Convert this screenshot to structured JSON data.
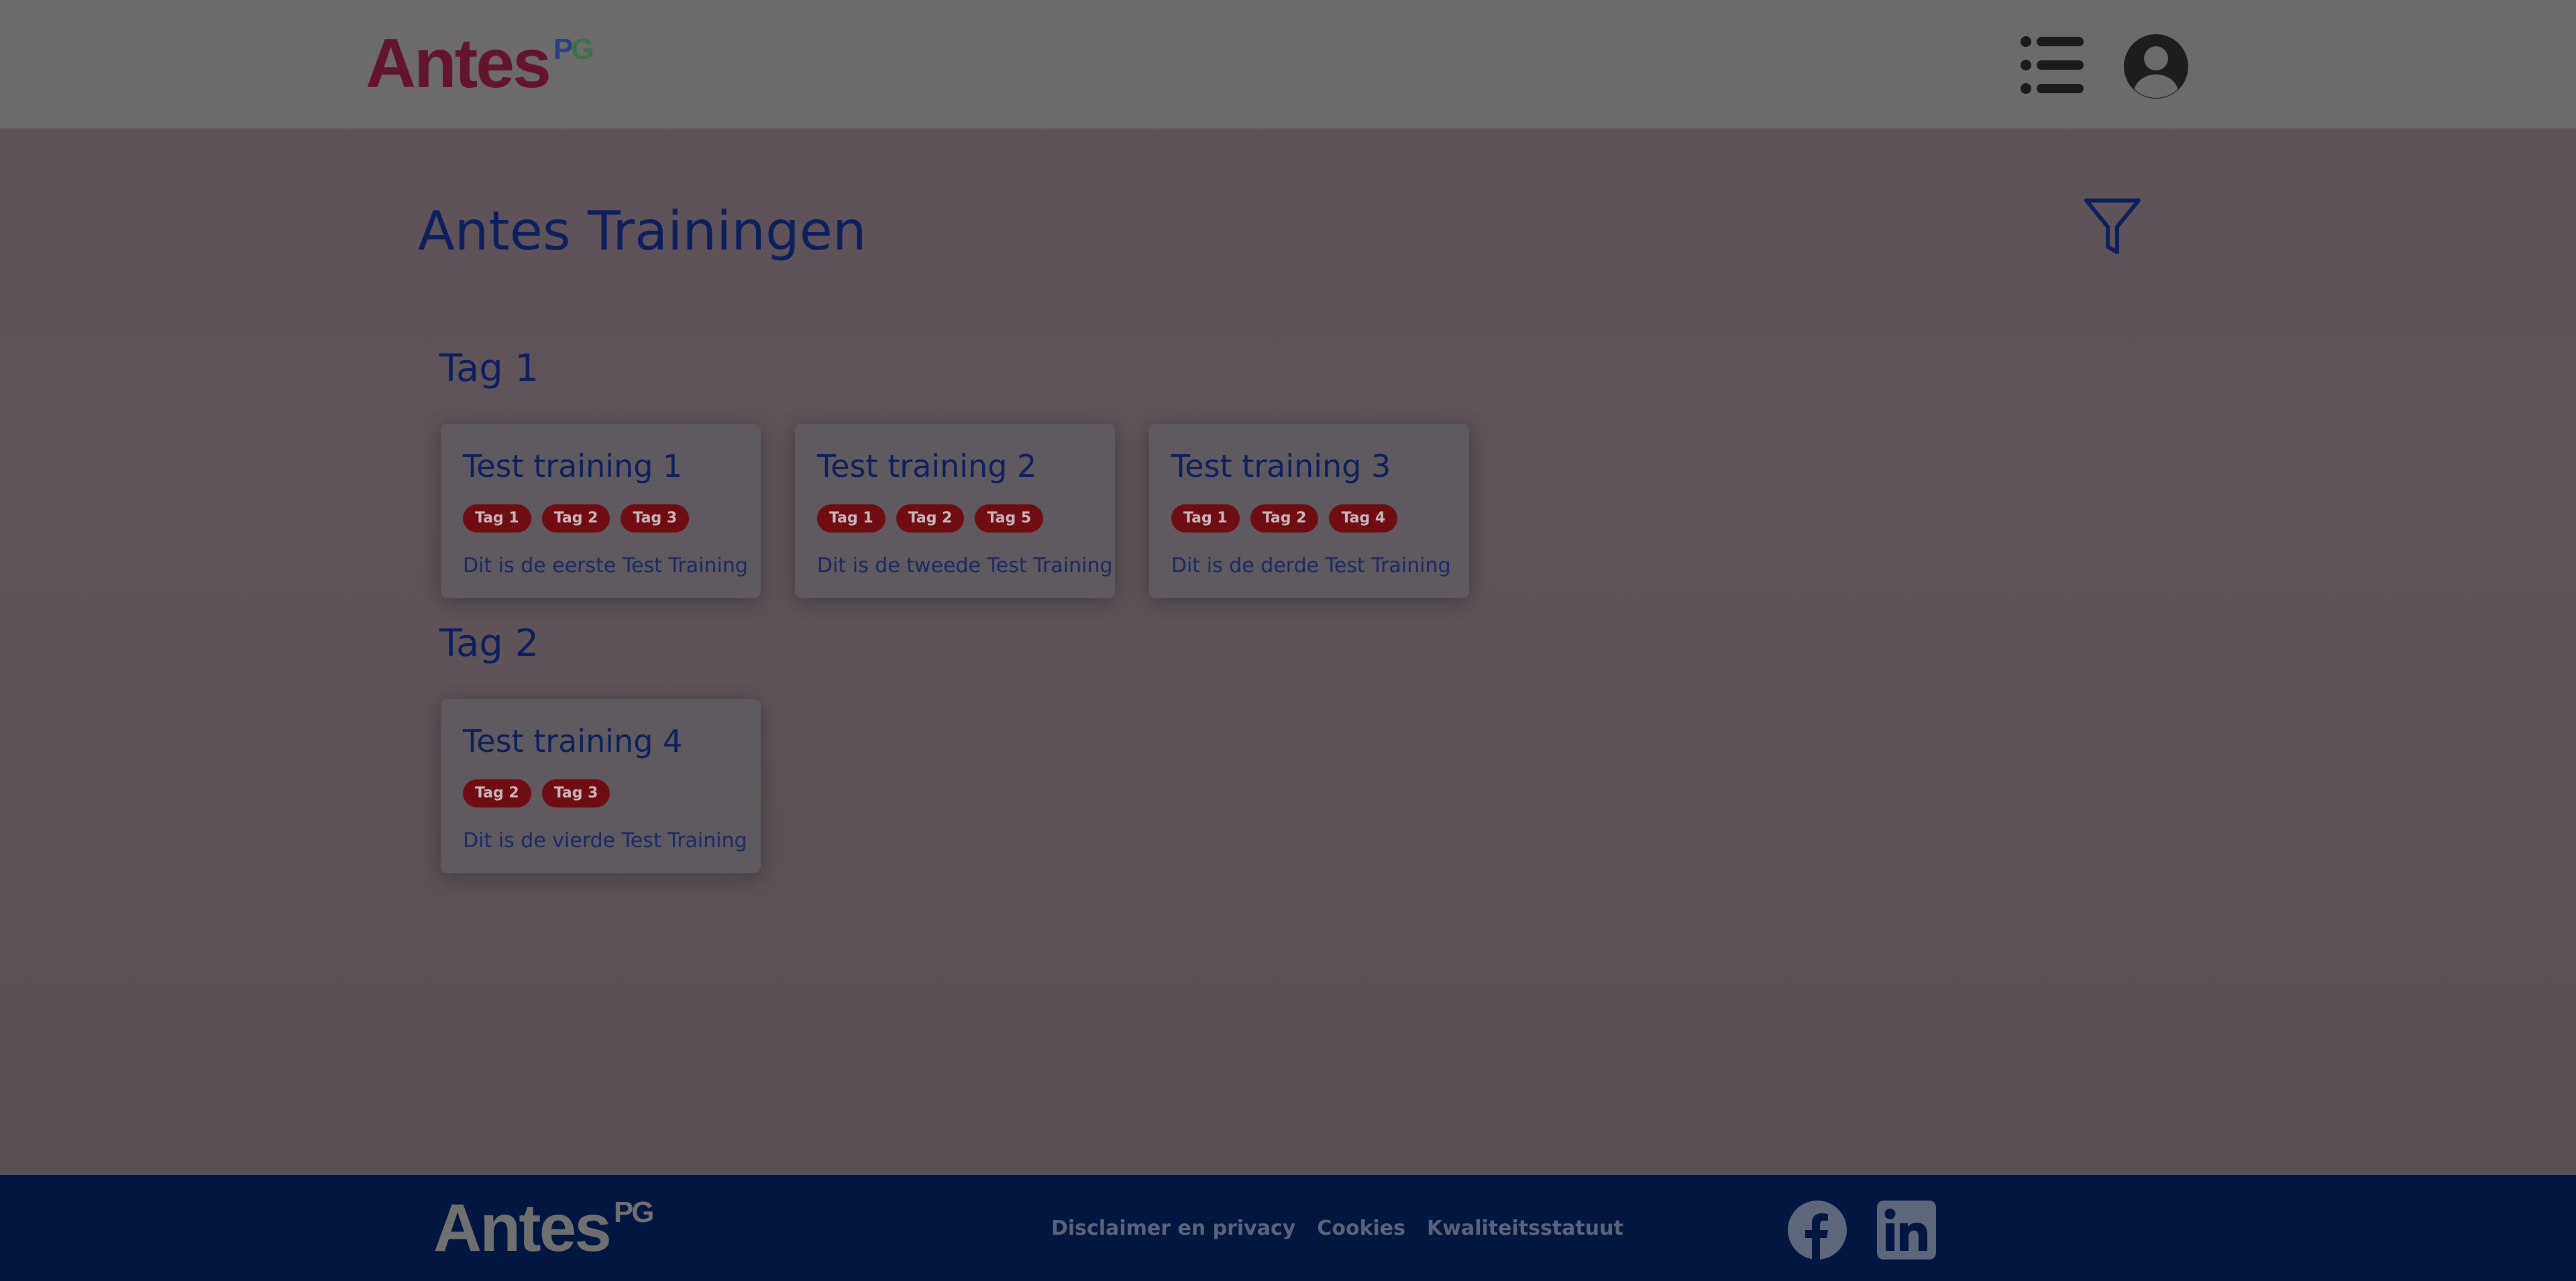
{
  "header": {
    "logo_text": "Antes",
    "logo_superscript_p": "P",
    "logo_superscript_g": "G"
  },
  "main": {
    "title": "Antes Trainingen",
    "sections": [
      {
        "heading": "Tag 1",
        "cards": [
          {
            "title": "Test training 1",
            "tags": [
              "Tag 1",
              "Tag 2",
              "Tag 3"
            ],
            "description": "Dit is de eerste Test Training"
          },
          {
            "title": "Test training 2",
            "tags": [
              "Tag 1",
              "Tag 2",
              "Tag 5"
            ],
            "description": "Dit is de tweede Test Training"
          },
          {
            "title": "Test training 3",
            "tags": [
              "Tag 1",
              "Tag 2",
              "Tag 4"
            ],
            "description": "Dit is de derde Test Training"
          }
        ]
      },
      {
        "heading": "Tag 2",
        "cards": [
          {
            "title": "Test training 4",
            "tags": [
              "Tag 2",
              "Tag 3"
            ],
            "description": "Dit is de vierde Test Training"
          }
        ]
      }
    ]
  },
  "footer": {
    "logo_text": "Antes",
    "logo_superscript": "PG",
    "links": [
      "Disclaimer en privacy",
      "Cookies",
      "Kwaliteitsstatuut"
    ]
  },
  "icons": {
    "menu": "menu-list-icon",
    "profile": "user-account-icon",
    "filter": "filter-funnel-icon",
    "facebook": "facebook-icon",
    "linkedin": "linkedin-icon"
  },
  "colors": {
    "header_bg": "#6b6b6b",
    "page_bg": "#5d5258",
    "accent_dark_blue": "#0e1f5c",
    "tag_bg": "#6f0c14",
    "footer_bg": "#02163f",
    "logo_red": "#62152b"
  }
}
